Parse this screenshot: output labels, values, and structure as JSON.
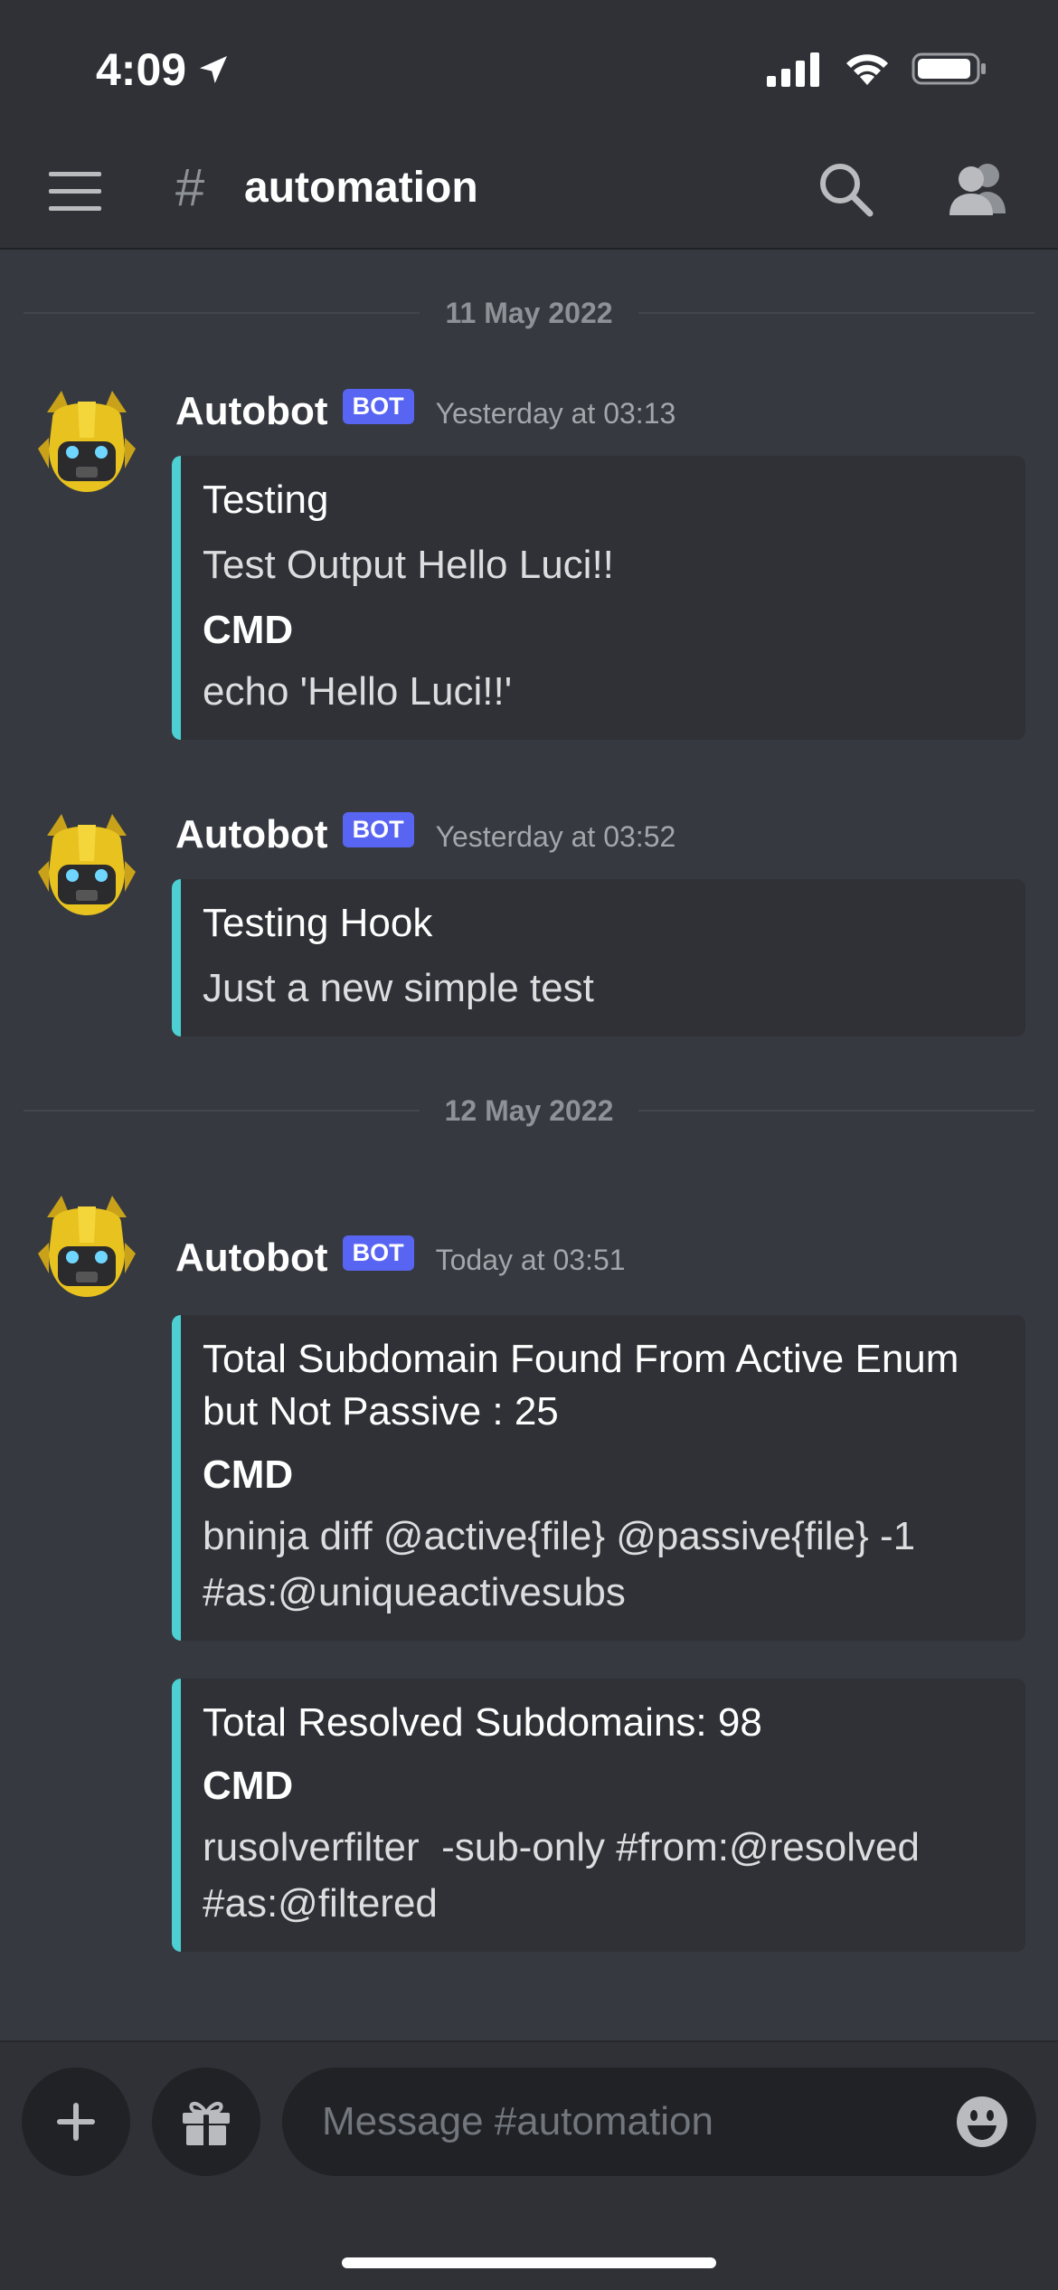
{
  "status_bar": {
    "time": "4:09",
    "icons": [
      "location-arrow-icon",
      "cellular-signal-icon",
      "wifi-icon",
      "battery-icon"
    ]
  },
  "header": {
    "channel_prefix": "#",
    "channel_name": "automation",
    "icons": [
      "hamburger-menu-icon",
      "search-icon",
      "members-icon"
    ]
  },
  "colors": {
    "embed_accent": "#4dd0d4",
    "bot_badge": "#5865f2",
    "background": "#36393f"
  },
  "dividers": [
    "11 May 2022",
    "12 May 2022"
  ],
  "messages": [
    {
      "author": "Autobot",
      "badge": "BOT",
      "timestamp": "Yesterday at 03:13",
      "embeds": [
        {
          "title": "Testing",
          "description": "Test Output Hello Luci!!",
          "field_name": "CMD",
          "field_value": "echo 'Hello Luci!!'"
        }
      ]
    },
    {
      "author": "Autobot",
      "badge": "BOT",
      "timestamp": "Yesterday at 03:52",
      "embeds": [
        {
          "title": "Testing Hook",
          "description": "Just a new simple test"
        }
      ]
    },
    {
      "author": "Autobot",
      "badge": "BOT",
      "timestamp": "Today at 03:51",
      "embeds": [
        {
          "title": "Total Subdomain Found From Active Enum but Not Passive : 25",
          "field_name": "CMD",
          "field_value": "bninja diff @active{file} @passive{file} -1 #as:@uniqueactivesubs"
        },
        {
          "title": "Total Resolved Subdomains: 98",
          "field_name": "CMD",
          "field_value": "rusolverfilter  -sub-only #from:@resolved #as:@filtered"
        }
      ]
    }
  ],
  "composer": {
    "placeholder": "Message #automation",
    "icons": [
      "plus-icon",
      "gift-icon",
      "emoji-icon"
    ]
  }
}
